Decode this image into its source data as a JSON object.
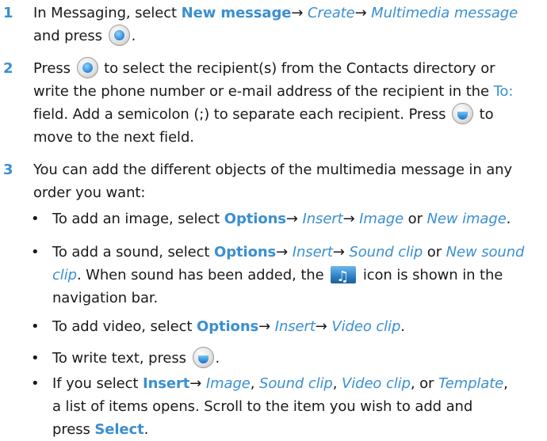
{
  "steps": [
    {
      "num": "1",
      "pre": "In Messaging, select",
      "cmd1": "New message",
      "arrow1": "→",
      "it1": "Create",
      "arrow2": "→",
      "it2": "Multimedia message",
      "post": "and press",
      "end": "."
    },
    {
      "num": "2",
      "a": "Press",
      "b": "to select the recipient(s) from the Contacts directory or",
      "c": "write the phone number or e-mail address of the recipient in the",
      "field": "To:",
      "d": "field. Add a semicolon (;) to separate each recipient. Press",
      "e": "to",
      "f": "move to the next field."
    },
    {
      "num": "3",
      "line1": "You can add the different objects of the multimedia message in any",
      "line2": "order you want:"
    }
  ],
  "bullets": [
    {
      "dot": "•",
      "pre": "To add an image, select",
      "cmd": "Options",
      "arrow1": "→",
      "it1": "Insert",
      "arrow2": "→",
      "it2": "Image",
      "or": "or",
      "it3": "New image",
      "end": "."
    },
    {
      "dot": "•",
      "pre": "To add a sound, select",
      "cmd": "Options",
      "arrow1": "→",
      "it1": "Insert",
      "arrow2": "→",
      "it2": "Sound clip",
      "or": "or",
      "it3a": "New sound",
      "it3b": "clip",
      "mid": ". When sound has been added, the",
      "after": "icon is shown in the",
      "last": "navigation bar.",
      "icon": "sound-clip-icon"
    },
    {
      "dot": "•",
      "pre": "To add video, select",
      "cmd": "Options",
      "arrow1": "→",
      "it1": "Insert",
      "arrow2": "→",
      "it2": "Video clip",
      "end": "."
    },
    {
      "dot": "•",
      "pre": "To write text, press",
      "end": "."
    },
    {
      "dot": "•",
      "pre": "If you select",
      "cmd": "Insert",
      "arrow1": "→",
      "it1": "Image",
      "sep1": ",",
      "it2": "Sound clip",
      "sep2": ",",
      "it3": "Video clip",
      "sep3": ", or",
      "it4": "Template",
      "sep4": ",",
      "line2": "a list of items opens. Scroll to the item you wish to add and",
      "line3pre": "press",
      "cmd2": "Select",
      "end": "."
    }
  ],
  "colors": {
    "accent": "#3a8fd1",
    "text": "#1a1a1a"
  }
}
